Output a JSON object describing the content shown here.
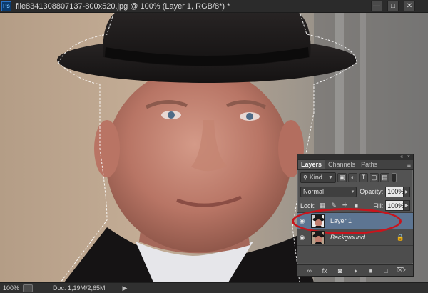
{
  "window": {
    "app_badge": "Ps",
    "title": "file8341308807137-800x520.jpg @ 100% (Layer 1, RGB/8*) *",
    "min_symbol": "—",
    "max_symbol": "□",
    "close_symbol": "✕"
  },
  "status": {
    "zoom": "100%",
    "doc": "Doc: 1,19M/2,65M",
    "arrow": "▶"
  },
  "layers_panel": {
    "tabs": [
      "Layers",
      "Channels",
      "Paths"
    ],
    "menu_icon": "≡",
    "filter": {
      "kind_label": "Kind",
      "icons": [
        "pixel-filter-icon",
        "adjustment-filter-icon",
        "type-filter-icon",
        "shape-filter-icon",
        "smart-object-filter-icon"
      ],
      "glyphs": [
        "▣",
        "◐",
        "T",
        "▢",
        "▤"
      ]
    },
    "blend_mode": "Normal",
    "opacity_label": "Opacity:",
    "opacity_value": "100%",
    "lock_label": "Lock:",
    "lock_glyphs": [
      "▦",
      "✎",
      "✛",
      "■"
    ],
    "fill_label": "Fill:",
    "fill_value": "100%",
    "layers": [
      {
        "name": "Layer 1",
        "visible": true,
        "selected": true,
        "locked": false
      },
      {
        "name": "Background",
        "visible": true,
        "selected": false,
        "locked": true
      }
    ],
    "footer_glyphs": [
      "∞",
      "fx",
      "◙",
      "◑",
      "■",
      "□",
      "⌦"
    ],
    "lock_glyph": "🔒",
    "eye_glyph": "◉"
  },
  "colors": {
    "selected_layer": "#5d7592",
    "highlight_oval": "#c8141c"
  }
}
